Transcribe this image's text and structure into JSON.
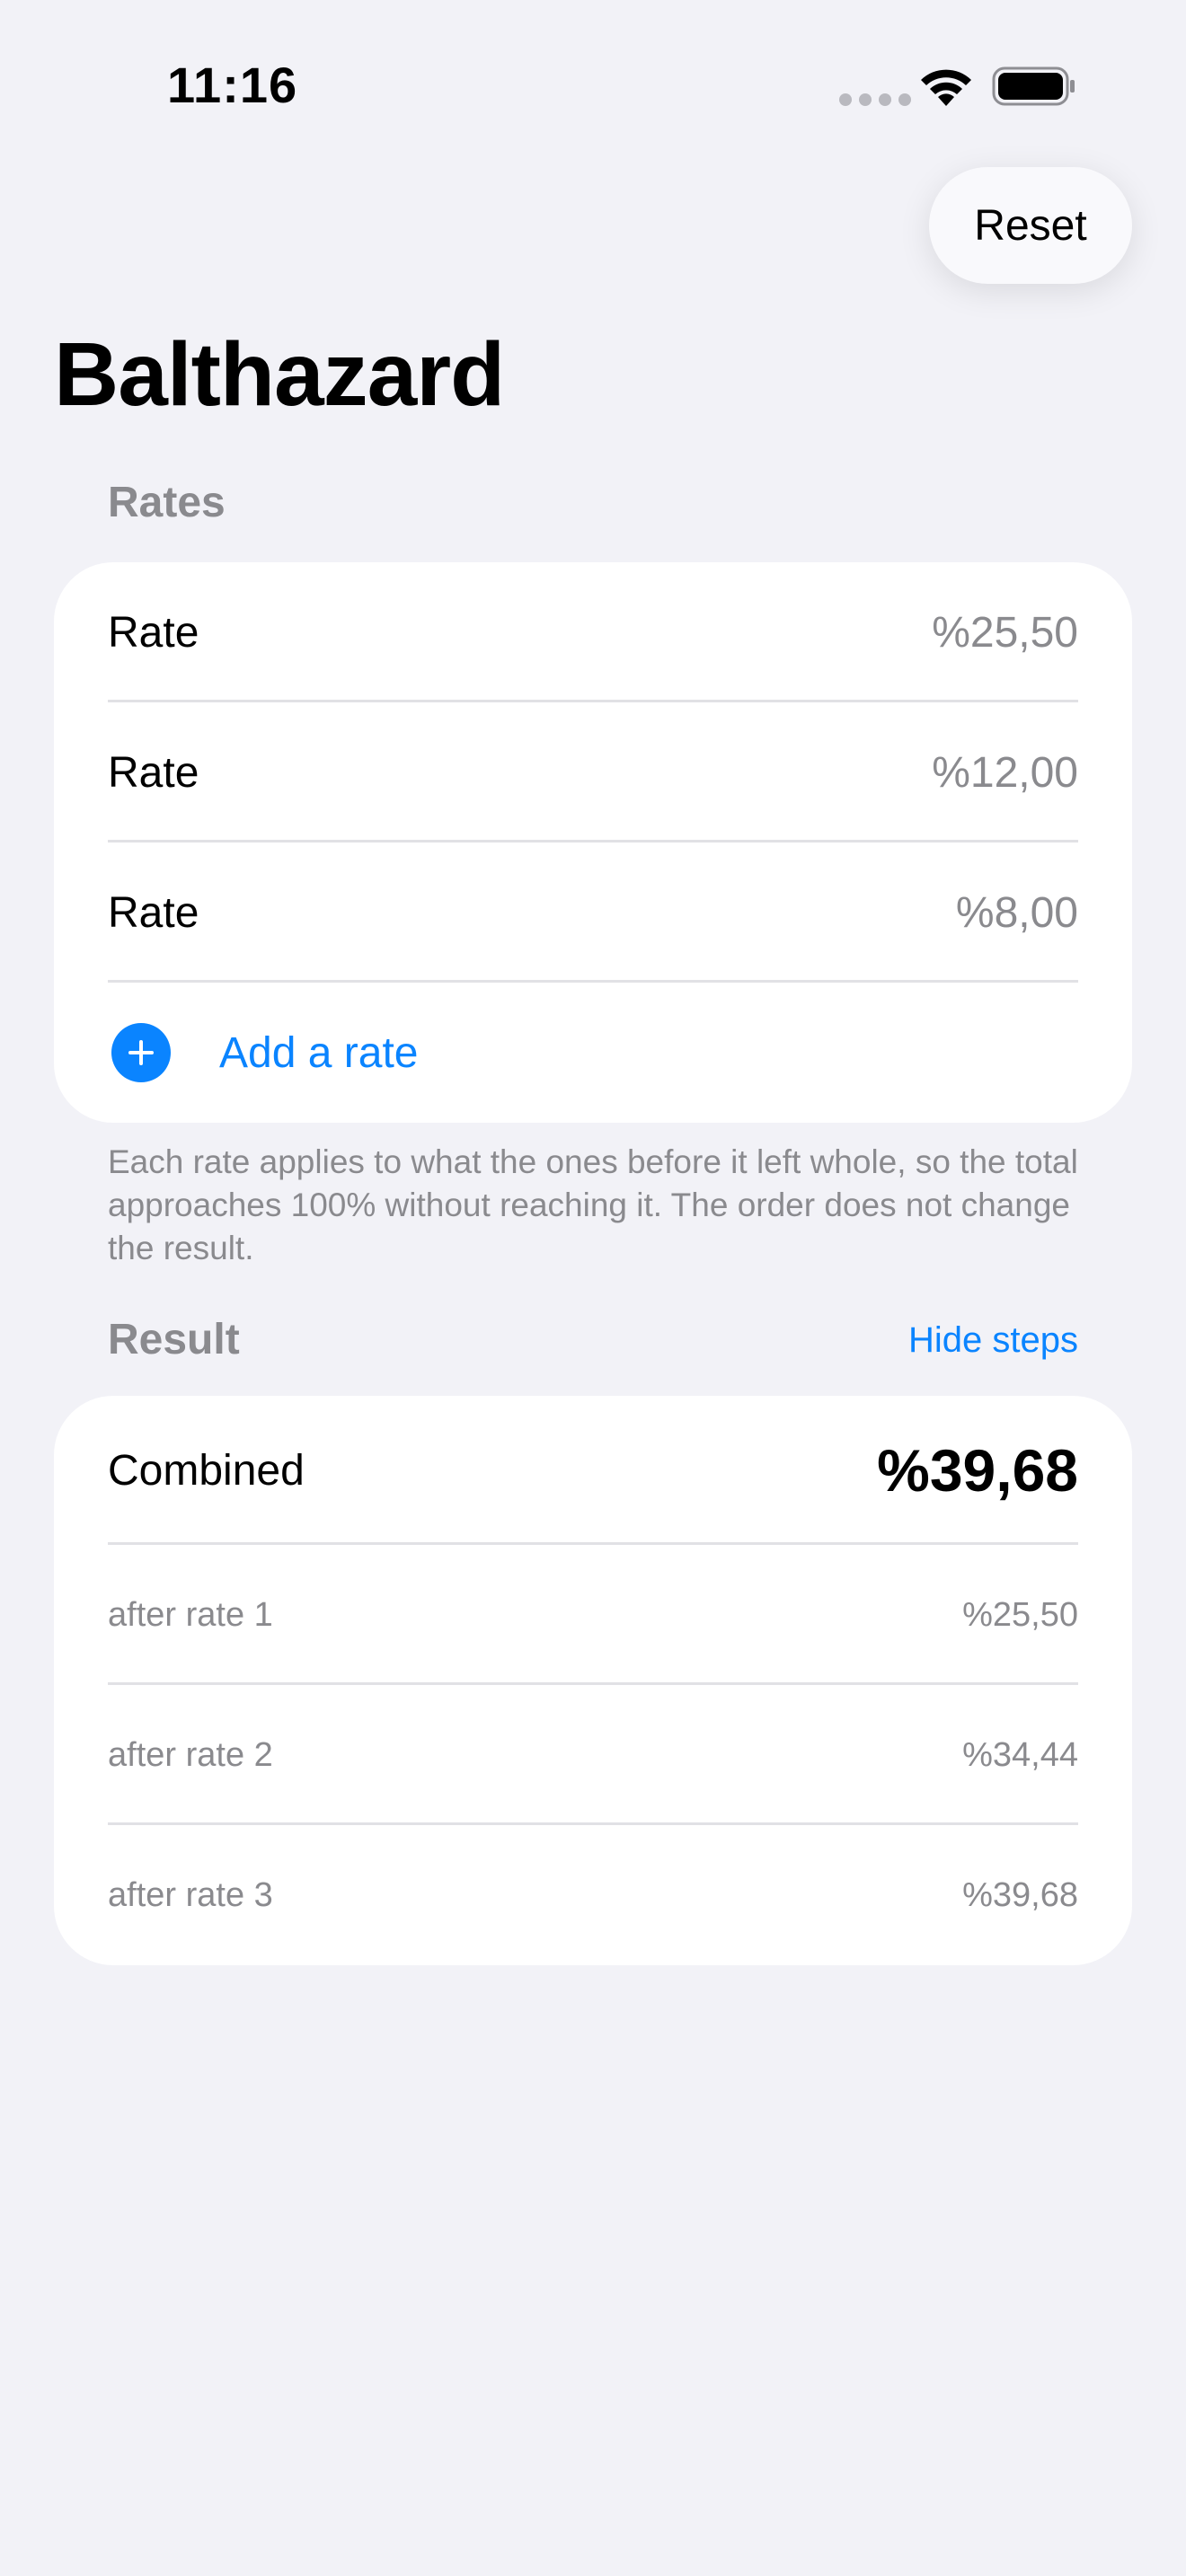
{
  "status_bar": {
    "time": "11:16",
    "icons": [
      "cellular-signal-icon",
      "wifi-icon",
      "battery-icon"
    ]
  },
  "toolbar": {
    "reset_label": "Reset"
  },
  "title": "Balthazard",
  "rates_section": {
    "header": "Rates",
    "items": [
      {
        "label": "Rate",
        "value": "%25,50"
      },
      {
        "label": "Rate",
        "value": "%12,00"
      },
      {
        "label": "Rate",
        "value": "%8,00"
      }
    ],
    "add_label": "Add a rate",
    "footnote": "Each rate applies to what the ones before it left whole, so the total approaches 100% without reaching it. The order does not change the result."
  },
  "result_section": {
    "header": "Result",
    "toggle_label": "Hide steps",
    "combined_label": "Combined",
    "combined_value": "%39,68",
    "steps": [
      {
        "label": "after rate 1",
        "value": "%25,50"
      },
      {
        "label": "after rate 2",
        "value": "%34,44"
      },
      {
        "label": "after rate 3",
        "value": "%39,68"
      }
    ]
  },
  "colors": {
    "background": "#f2f2f7",
    "accent": "#0a84ff",
    "secondary_text": "#8a8a8e"
  }
}
